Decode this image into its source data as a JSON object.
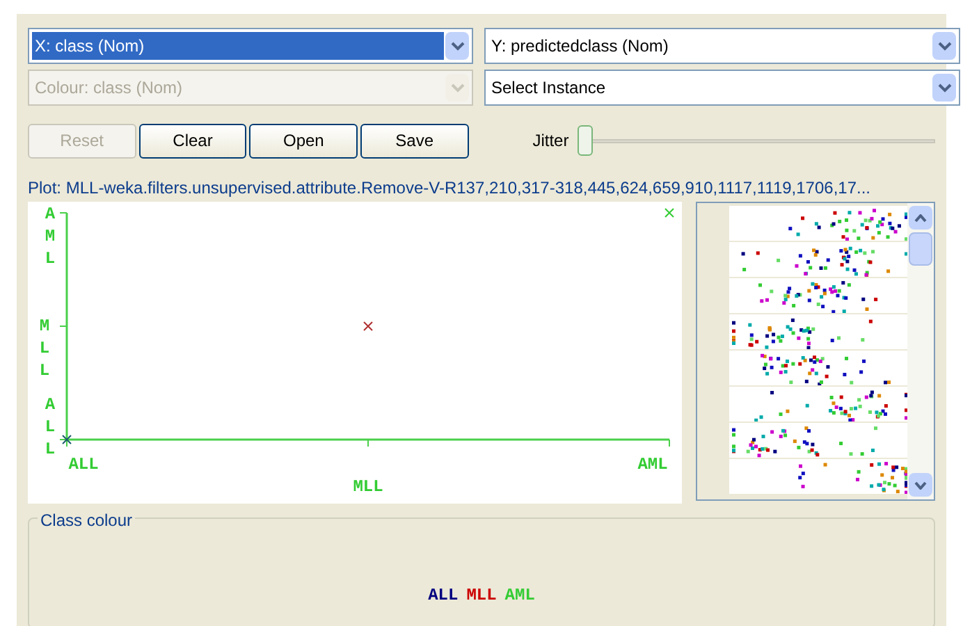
{
  "dropdowns": [
    {
      "label": "X: class (Nom)",
      "highlighted": true,
      "disabled": false
    },
    {
      "label": "Y: predictedclass (Nom)",
      "highlighted": false,
      "disabled": false
    },
    {
      "label": "Colour: class (Nom)",
      "highlighted": false,
      "disabled": true
    },
    {
      "label": "Select Instance",
      "highlighted": false,
      "disabled": false
    }
  ],
  "buttons": [
    {
      "label": "Reset",
      "disabled": true
    },
    {
      "label": "Clear",
      "disabled": false
    },
    {
      "label": "Open",
      "disabled": false
    },
    {
      "label": "Save",
      "disabled": false
    }
  ],
  "jitter": {
    "label": "Jitter",
    "level": 0
  },
  "plot": {
    "title": "Plot: MLL-weka.filters.unsupervised.attribute.Remove-V-R137,210,317-318,445,624,659,910,1117,1119,1706,17...",
    "x_labels": [
      "ALL",
      "MLL",
      "AML"
    ],
    "y_labels": [
      "ALL",
      "MLL",
      "AML"
    ],
    "points": [
      {
        "color": "#1e5a6e"
      },
      {
        "color": "#b03030"
      },
      {
        "color": "#33cc33"
      }
    ]
  },
  "class_colour": {
    "title": "Class colour",
    "classes": [
      {
        "label": "ALL",
        "color": "#000080"
      },
      {
        "label": "MLL",
        "color": "#cc0000"
      },
      {
        "label": "AML",
        "color": "#33cc33"
      }
    ]
  }
}
